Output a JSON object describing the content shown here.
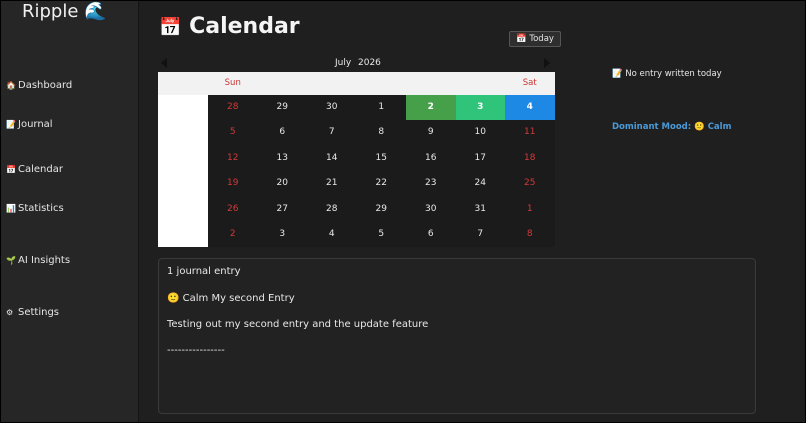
{
  "app": {
    "name": "Ripple",
    "logo_icon": "🌊"
  },
  "sidebar": {
    "items": [
      {
        "icon": "🏠",
        "label": "Dashboard"
      },
      {
        "icon": "📝",
        "label": "Journal"
      },
      {
        "icon": "📅",
        "label": "Calendar"
      },
      {
        "icon": "📊",
        "label": "Statistics"
      },
      {
        "icon": "🌱",
        "label": "AI Insights"
      },
      {
        "icon": "⚙",
        "label": "Settings"
      }
    ]
  },
  "header": {
    "title_icon": "📅",
    "title": "Calendar",
    "today_icon": "📅",
    "today_label": "Today"
  },
  "calendar": {
    "month": "July",
    "year": "2026",
    "weekday_headers": [
      "Sun",
      "",
      "",
      "",
      "",
      "",
      "Sat"
    ],
    "weeks": [
      {
        "days": [
          "28",
          "29",
          "30",
          "1",
          "2",
          "3",
          "4"
        ]
      },
      {
        "days": [
          "5",
          "6",
          "7",
          "8",
          "9",
          "10",
          "11"
        ]
      },
      {
        "days": [
          "12",
          "13",
          "14",
          "15",
          "16",
          "17",
          "18"
        ]
      },
      {
        "days": [
          "19",
          "20",
          "21",
          "22",
          "23",
          "24",
          "25"
        ]
      },
      {
        "days": [
          "26",
          "27",
          "28",
          "29",
          "30",
          "31",
          "1"
        ]
      },
      {
        "days": [
          "2",
          "3",
          "4",
          "5",
          "6",
          "7",
          "8"
        ]
      }
    ],
    "highlights": [
      {
        "day": "2",
        "color": "#46a04a"
      },
      {
        "day": "3",
        "color": "#2fc47a"
      },
      {
        "day": "4",
        "color": "#1e88e5"
      }
    ]
  },
  "panel": {
    "no_entry_icon": "📝",
    "no_entry_text": "No entry written today",
    "mood_label": "Dominant Mood:",
    "mood_icon": "🙂",
    "mood_value": "Calm"
  },
  "entries": {
    "count_text": "1 journal entry",
    "entry_icon": "🙂",
    "entry_heading": "Calm My second Entry",
    "entry_body": "Testing out my second entry and the update feature",
    "separator": "----------------"
  }
}
